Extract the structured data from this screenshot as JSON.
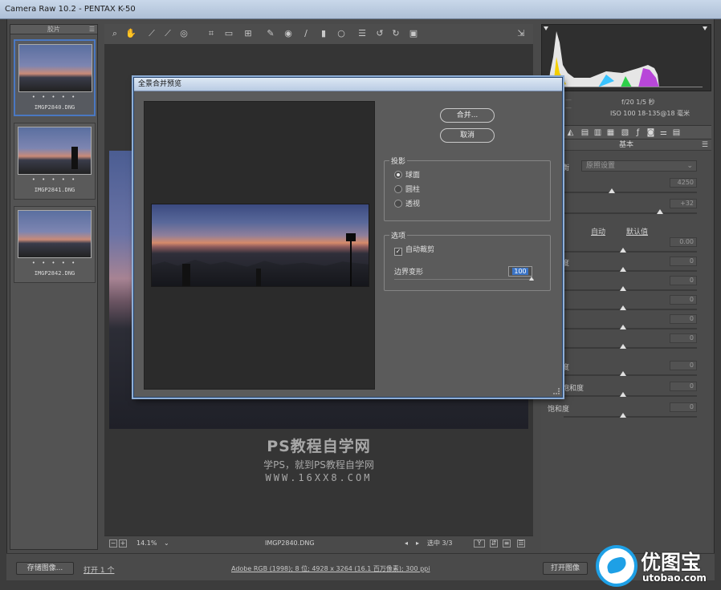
{
  "window": {
    "title": "Camera Raw 10.2  -  PENTAX K-50"
  },
  "filmstrip": {
    "header": "胶片",
    "menu_icon": "☰",
    "items": [
      {
        "stars": "• • • • •",
        "name": "IMGP2840.DNG",
        "selected": true
      },
      {
        "stars": "• • • • •",
        "name": "IMGP2841.DNG",
        "selected": false
      },
      {
        "stars": "• • • • •",
        "name": "IMGP2842.DNG",
        "selected": false
      }
    ]
  },
  "toolbar": {
    "icons": [
      "zoom-icon",
      "hand-icon",
      "white-balance-icon",
      "color-sampler-icon",
      "targeted-adjust-icon",
      "crop-icon",
      "straighten-icon",
      "transform-icon",
      "spot-removal-icon",
      "red-eye-icon",
      "adjustment-brush-icon",
      "graduated-filter-icon",
      "radial-filter-icon",
      "preferences-icon",
      "rotate-ccw-icon",
      "rotate-cw-icon",
      "trash-icon"
    ],
    "fullscreen_icon": "fullscreen-icon"
  },
  "preview": {
    "watermark_title": "PS教程自学网",
    "watermark_sub": "学PS，就到PS教程自学网",
    "watermark_url": "WWW.16XX8.COM"
  },
  "preview_status": {
    "zoom": "14.1%",
    "filename": "IMGP2840.DNG",
    "selection": "选中 3/3"
  },
  "camera_info": {
    "line1": "f/20   1/5 秒",
    "line2": "ISO 100   18-135@18 毫米"
  },
  "panel": {
    "title": "基本",
    "wb_label": "白平衡",
    "wb_value": "原照设置",
    "temp_value": "4250",
    "tint_value": "+32",
    "auto_link": "自动",
    "default_link": "默认值",
    "exposure_value": "0.00",
    "sliders": [
      {
        "label": "曝光",
        "value": "0.00"
      },
      {
        "label": "对比度",
        "value": "0"
      },
      {
        "label": "高光",
        "value": "0"
      },
      {
        "label": "阴影",
        "value": "0"
      },
      {
        "label": "白色",
        "value": "0"
      },
      {
        "label": "黑色",
        "value": "0"
      },
      {
        "label": "清晰度",
        "value": "0"
      },
      {
        "label": "自然饱和度",
        "value": "0"
      },
      {
        "label": "饱和度",
        "value": "0"
      }
    ]
  },
  "bottom_bar": {
    "save_button": "存储图像...",
    "save_more": "打开 1 个",
    "workflow": "Adobe RGB (1998); 8 位; 4928 x 3264 (16.1 百万像素); 300 ppi",
    "open_button": "打开图像"
  },
  "brand": {
    "name": "优图宝",
    "url": "utobao.com"
  },
  "dialog": {
    "title": "全景合并预览",
    "merge_button": "合并...",
    "cancel_button": "取消",
    "projection_label": "投影",
    "projection_options": [
      {
        "label": "球面",
        "selected": true
      },
      {
        "label": "圆柱",
        "selected": false
      },
      {
        "label": "透视",
        "selected": false
      }
    ],
    "options_label": "选项",
    "auto_crop_label": "自动裁剪",
    "auto_crop_checked": true,
    "boundary_label": "边界变形",
    "boundary_value": "100"
  }
}
